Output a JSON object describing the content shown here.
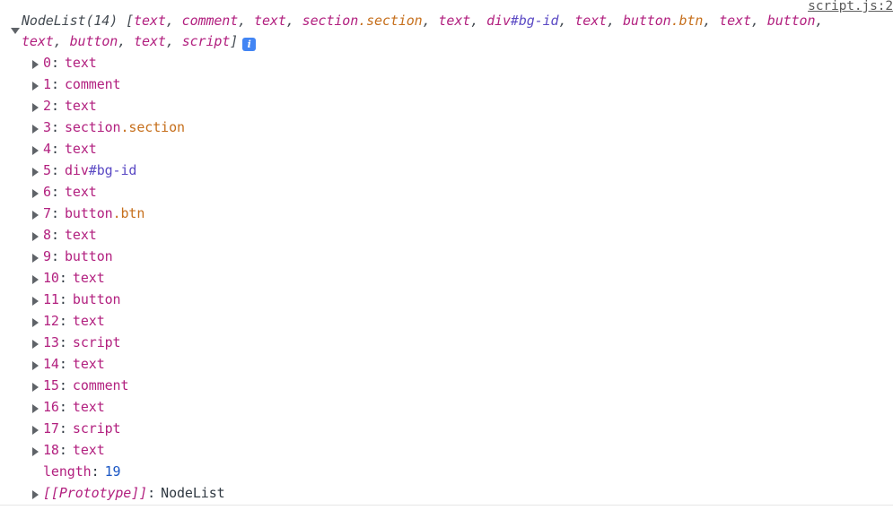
{
  "source": {
    "link_label": "script.js:2"
  },
  "group": {
    "type_label": "NodeList(14)",
    "open_bracket": " [",
    "close_bracket": "]",
    "separator": ", ",
    "info_icon_label": "i",
    "preview_items": [
      {
        "tag": "text",
        "class": "",
        "id": ""
      },
      {
        "tag": "comment",
        "class": "",
        "id": ""
      },
      {
        "tag": "text",
        "class": "",
        "id": ""
      },
      {
        "tag": "section",
        "class": ".section",
        "id": ""
      },
      {
        "tag": "text",
        "class": "",
        "id": ""
      },
      {
        "tag": "div",
        "class": "",
        "id": "#bg-id"
      },
      {
        "tag": "text",
        "class": "",
        "id": ""
      },
      {
        "tag": "button",
        "class": ".btn",
        "id": ""
      },
      {
        "tag": "text",
        "class": "",
        "id": ""
      },
      {
        "tag": "button",
        "class": "",
        "id": ""
      },
      {
        "tag": "text",
        "class": "",
        "id": ""
      },
      {
        "tag": "button",
        "class": "",
        "id": ""
      },
      {
        "tag": "text",
        "class": "",
        "id": ""
      },
      {
        "tag": "script",
        "class": "",
        "id": ""
      }
    ]
  },
  "rows": [
    {
      "key": "0",
      "tag": "text",
      "class": "",
      "id": "",
      "expandable": true,
      "kind": "node"
    },
    {
      "key": "1",
      "tag": "comment",
      "class": "",
      "id": "",
      "expandable": true,
      "kind": "node"
    },
    {
      "key": "2",
      "tag": "text",
      "class": "",
      "id": "",
      "expandable": true,
      "kind": "node"
    },
    {
      "key": "3",
      "tag": "section",
      "class": ".section",
      "id": "",
      "expandable": true,
      "kind": "node"
    },
    {
      "key": "4",
      "tag": "text",
      "class": "",
      "id": "",
      "expandable": true,
      "kind": "node"
    },
    {
      "key": "5",
      "tag": "div",
      "class": "",
      "id": "#bg-id",
      "expandable": true,
      "kind": "node"
    },
    {
      "key": "6",
      "tag": "text",
      "class": "",
      "id": "",
      "expandable": true,
      "kind": "node"
    },
    {
      "key": "7",
      "tag": "button",
      "class": ".btn",
      "id": "",
      "expandable": true,
      "kind": "node"
    },
    {
      "key": "8",
      "tag": "text",
      "class": "",
      "id": "",
      "expandable": true,
      "kind": "node"
    },
    {
      "key": "9",
      "tag": "button",
      "class": "",
      "id": "",
      "expandable": true,
      "kind": "node"
    },
    {
      "key": "10",
      "tag": "text",
      "class": "",
      "id": "",
      "expandable": true,
      "kind": "node"
    },
    {
      "key": "11",
      "tag": "button",
      "class": "",
      "id": "",
      "expandable": true,
      "kind": "node"
    },
    {
      "key": "12",
      "tag": "text",
      "class": "",
      "id": "",
      "expandable": true,
      "kind": "node"
    },
    {
      "key": "13",
      "tag": "script",
      "class": "",
      "id": "",
      "expandable": true,
      "kind": "node"
    },
    {
      "key": "14",
      "tag": "text",
      "class": "",
      "id": "",
      "expandable": true,
      "kind": "node"
    },
    {
      "key": "15",
      "tag": "comment",
      "class": "",
      "id": "",
      "expandable": true,
      "kind": "node"
    },
    {
      "key": "16",
      "tag": "text",
      "class": "",
      "id": "",
      "expandable": true,
      "kind": "node"
    },
    {
      "key": "17",
      "tag": "script",
      "class": "",
      "id": "",
      "expandable": true,
      "kind": "node"
    },
    {
      "key": "18",
      "tag": "text",
      "class": "",
      "id": "",
      "expandable": true,
      "kind": "node"
    },
    {
      "key": "length",
      "value": "19",
      "expandable": false,
      "kind": "number",
      "italic": false
    },
    {
      "key": "[[Prototype]]",
      "value": "NodeList",
      "expandable": true,
      "kind": "plain",
      "italic": true
    }
  ],
  "colors": {
    "node_magenta": "#b2207f",
    "class_orange": "#c66f1c",
    "id_indigo": "#5a49c4",
    "number_blue": "#1a56c4",
    "text_dark": "#303942",
    "info_blue": "#4285f4",
    "arrow_gray": "#5f6368",
    "background": "#ffffff"
  }
}
